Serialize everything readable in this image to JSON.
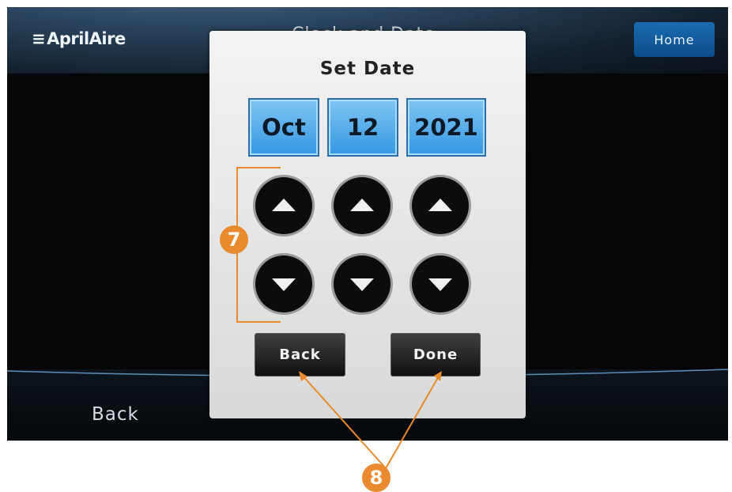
{
  "header": {
    "logo_text": "AprilAire",
    "home_label": "Home"
  },
  "footer": {
    "back_label": "Back"
  },
  "dialog": {
    "title": "Set Date",
    "month": "Oct",
    "day": "12",
    "year": "2021",
    "back_label": "Back",
    "done_label": "Done"
  },
  "callouts": {
    "arrows": "7",
    "buttons": "8"
  },
  "colors": {
    "accent_orange": "#e88a2d",
    "date_blue": "#47a8ea",
    "home_blue": "#1160a0"
  }
}
